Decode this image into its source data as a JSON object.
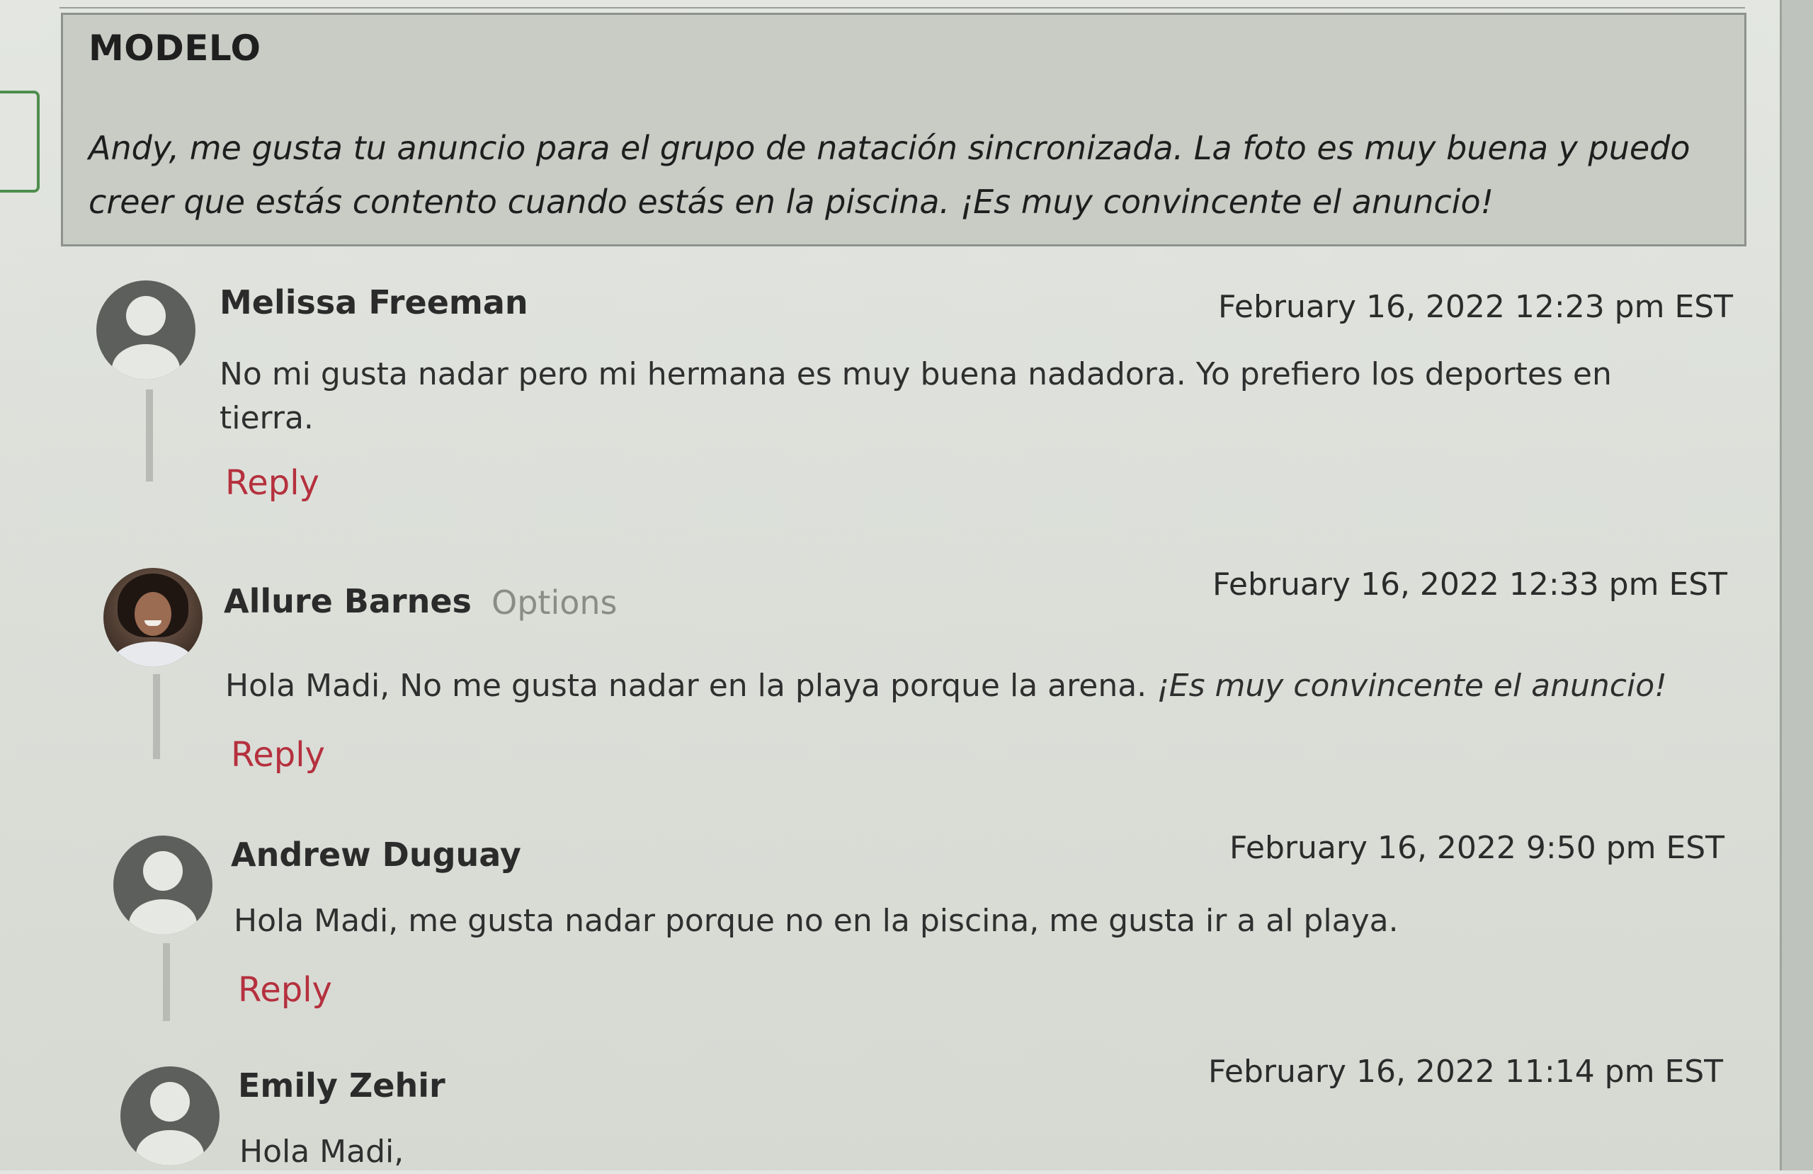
{
  "modelo": {
    "title": "MODELO",
    "text": "Andy, me gusta tu anuncio para el grupo de natación sincronizada. La foto es muy buena y puedo creer que estás contento cuando estás en la piscina. ¡Es muy convincente el anuncio!"
  },
  "comments": [
    {
      "author": "Melissa Freeman",
      "timestamp": "February 16, 2022 12:23 pm EST",
      "body": "No mi gusta nadar pero mi hermana es muy buena nadadora. Yo prefiero los deportes en tierra.",
      "reply": "Reply"
    },
    {
      "author": "Allure Barnes",
      "options": "Options",
      "timestamp": "February 16, 2022 12:33 pm EST",
      "body": "Hola Madi, No me gusta nadar en la playa porque la arena.",
      "body_italic": "¡Es muy convincente el anuncio!",
      "reply": "Reply"
    },
    {
      "author": "Andrew Duguay",
      "timestamp": "February 16, 2022 9:50 pm EST",
      "body": "Hola Madi, me gusta nadar porque no en la piscina, me gusta ir a al playa.",
      "reply": "Reply"
    },
    {
      "author": "Emily Zehir",
      "timestamp": "February 16, 2022 11:14 pm EST",
      "body": "Hola Madi,"
    }
  ],
  "colors": {
    "reply_link": "#b5303e",
    "options_link": "#8a8c88",
    "model_box": "#c8ccc5"
  }
}
